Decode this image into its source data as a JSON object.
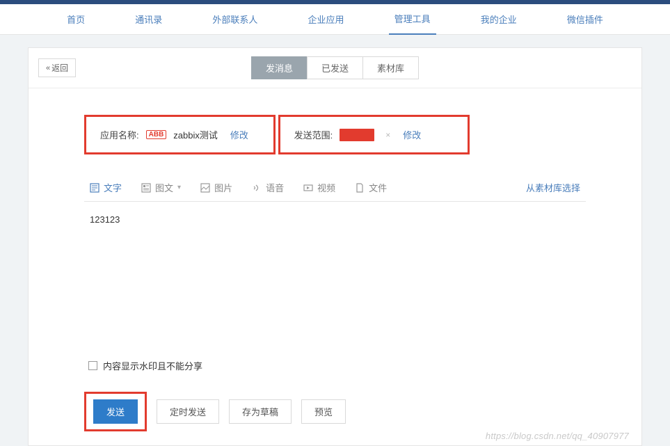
{
  "nav": {
    "items": [
      "首页",
      "通讯录",
      "外部联系人",
      "企业应用",
      "管理工具",
      "我的企业",
      "微信插件"
    ],
    "active_index": 4
  },
  "back_label": "返回",
  "tabs": {
    "items": [
      "发消息",
      "已发送",
      "素材库"
    ],
    "active_index": 0
  },
  "form": {
    "app_name_label": "应用名称:",
    "app_badge": "ABB",
    "app_name": "zabbix测试",
    "modify": "修改",
    "scope_label": "发送范围:"
  },
  "editor": {
    "tabs": {
      "text": "文字",
      "richtext": "图文",
      "image": "图片",
      "voice": "语音",
      "video": "视频",
      "file": "文件"
    },
    "select_from_library": "从素材库选择",
    "content": "123123"
  },
  "watermark_checkbox": "内容显示水印且不能分享",
  "actions": {
    "send": "发送",
    "schedule": "定时发送",
    "draft": "存为草稿",
    "preview": "预览"
  },
  "page_watermark": "https://blog.csdn.net/qq_40907977"
}
